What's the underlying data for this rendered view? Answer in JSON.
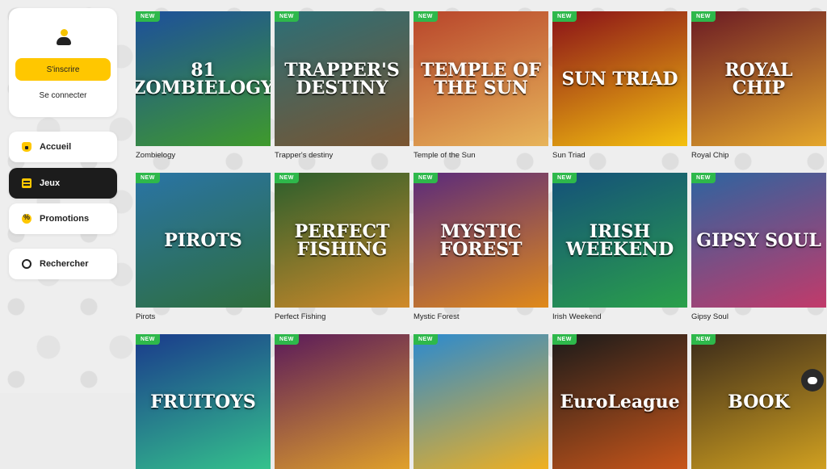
{
  "sidebar": {
    "signup_label": "S'inscrire",
    "login_label": "Se connecter",
    "nav": [
      {
        "label": "Accueil",
        "icon": "home-icon"
      },
      {
        "label": "Jeux",
        "icon": "games-icon",
        "active": true
      },
      {
        "label": "Promotions",
        "icon": "promotions-icon"
      },
      {
        "label": "Rechercher",
        "icon": "search-icon"
      }
    ]
  },
  "badge_text": "NEW",
  "games": [
    {
      "name": "Zombielogy",
      "art": "81 ZOMBIELOGY",
      "bg": "#1d4f9c",
      "bg2": "#3f9a2c"
    },
    {
      "name": "Trapper's destiny",
      "art": "TRAPPER'S DESTINY",
      "bg": "#2c6f77",
      "bg2": "#7a5430"
    },
    {
      "name": "Temple of the Sun",
      "art": "TEMPLE OF THE SUN",
      "bg": "#b8452b",
      "bg2": "#e7b45a"
    },
    {
      "name": "Sun Triad",
      "art": "SUN TRIAD",
      "bg": "#8a1018",
      "bg2": "#f4c10f"
    },
    {
      "name": "Royal Chip",
      "art": "ROYAL CHIP",
      "bg": "#6a1a24",
      "bg2": "#e4a62b"
    },
    {
      "name": "Pirots",
      "art": "PIROTS",
      "bg": "#2a74a6",
      "bg2": "#2e6e3c"
    },
    {
      "name": "Perfect Fishing",
      "art": "PERFECT FISHING",
      "bg": "#2a5e2c",
      "bg2": "#d08a2a"
    },
    {
      "name": "Mystic Forest",
      "art": "MYSTIC FOREST",
      "bg": "#5a2a7c",
      "bg2": "#e08a1a"
    },
    {
      "name": "Irish Weekend",
      "art": "IRISH WEEKEND",
      "bg": "#14507a",
      "bg2": "#2aa04a"
    },
    {
      "name": "Gipsy Soul",
      "art": "GIPSY SOUL",
      "bg": "#2d64a0",
      "bg2": "#c23a6a"
    },
    {
      "name": "",
      "art": "FRUITOYS",
      "bg": "#1a3a8c",
      "bg2": "#34c28c"
    },
    {
      "name": "",
      "art": "",
      "bg": "#5a1a5a",
      "bg2": "#e0a02a"
    },
    {
      "name": "",
      "art": "",
      "bg": "#2a8ad0",
      "bg2": "#f0b020"
    },
    {
      "name": "",
      "art": "EuroLeague",
      "bg": "#1a1a1a",
      "bg2": "#c8561a"
    },
    {
      "name": "",
      "art": "BOOK",
      "bg": "#3a2a1a",
      "bg2": "#d0a020"
    }
  ]
}
